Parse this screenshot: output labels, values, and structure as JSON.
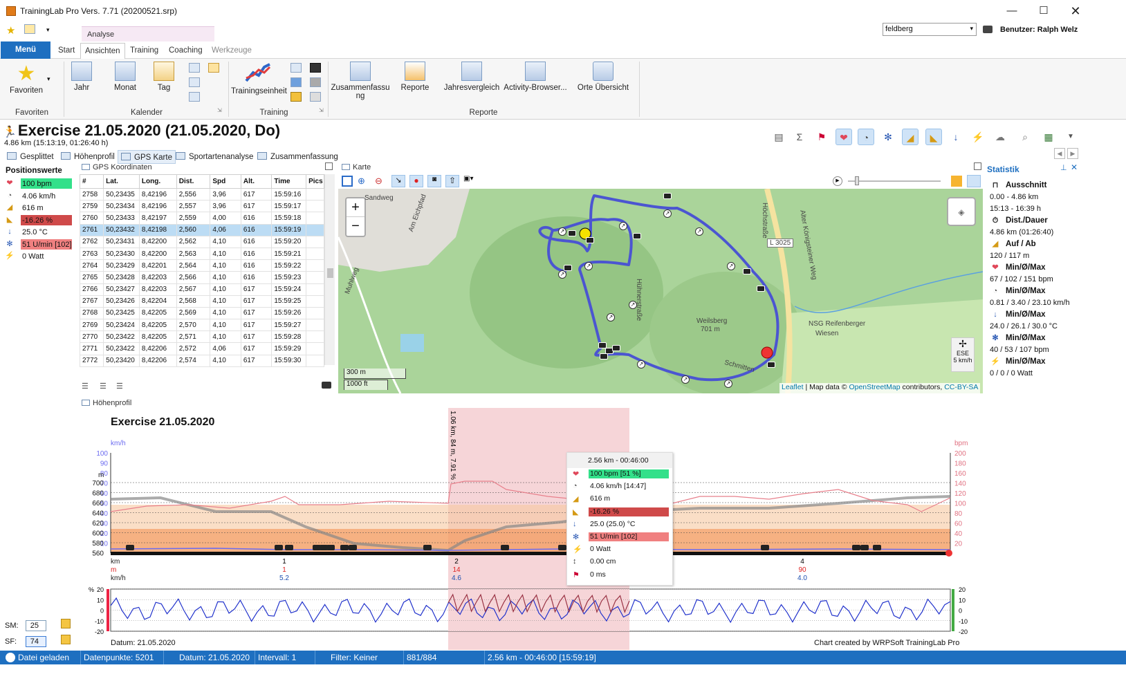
{
  "window": {
    "title": "TrainingLab Pro Vers. 7.71 (20200521.srp)",
    "user_select": "feldberg",
    "user_label": "Benutzer: Ralph Welz"
  },
  "ribbon": {
    "context_tab": "Analyse",
    "tabs": [
      "Menü",
      "Start",
      "Ansichten",
      "Training",
      "Coaching",
      "Werkzeuge"
    ],
    "groups": {
      "favoriten": {
        "label": "Favoriten",
        "buttons": [
          "Favoriten"
        ]
      },
      "kalender": {
        "label": "Kalender",
        "buttons": [
          "Jahr",
          "Monat",
          "Tag"
        ]
      },
      "training": {
        "label": "Training",
        "buttons": [
          "Trainingseinheit"
        ]
      },
      "reporte": {
        "label": "Reporte",
        "buttons": [
          "Zusammenfassu",
          "ng",
          "Reporte",
          "Jahresvergleich",
          "Activity-Browser...",
          "Orte Übersicht"
        ]
      }
    }
  },
  "exercise": {
    "title": "Exercise 21.05.2020 (21.05.2020, Do)",
    "subtitle": "4.86 km (15:13:19, 01:26:40 h)"
  },
  "view_tabs": [
    "Gesplittet",
    "Höhenprofil",
    "GPS Karte",
    "Sportartenanalyse",
    "Zusammenfassung"
  ],
  "position": {
    "header": "Positionswerte",
    "values": [
      {
        "icon": "heart-icon",
        "text": "100 bpm",
        "bg": "#33e08a"
      },
      {
        "icon": "speedometer-icon",
        "text": "4.06 km/h",
        "bg": ""
      },
      {
        "icon": "altitude-icon",
        "text": "616 m",
        "bg": ""
      },
      {
        "icon": "gradient-icon",
        "text": "-16.26 %",
        "bg": "#cf4a4a"
      },
      {
        "icon": "thermometer-icon",
        "text": "25.0 °C",
        "bg": ""
      },
      {
        "icon": "cadence-icon",
        "text": "51 U/min [102]",
        "bg": "#f08080"
      },
      {
        "icon": "power-icon",
        "text": "0 Watt",
        "bg": ""
      }
    ]
  },
  "gps": {
    "panel_title": "GPS Koordinaten",
    "columns": [
      "#",
      "Lat.",
      "Long.",
      "Dist.",
      "Spd",
      "Alt.",
      "Time",
      "Pics"
    ],
    "rows": [
      [
        "2758",
        "50,23435",
        "8,42196",
        "2,556",
        "3,96",
        "617",
        "15:59:16",
        ""
      ],
      [
        "2759",
        "50,23434",
        "8,42196",
        "2,557",
        "3,96",
        "617",
        "15:59:17",
        ""
      ],
      [
        "2760",
        "50,23433",
        "8,42197",
        "2,559",
        "4,00",
        "616",
        "15:59:18",
        ""
      ],
      [
        "2761",
        "50,23432",
        "8,42198",
        "2,560",
        "4,06",
        "616",
        "15:59:19",
        ""
      ],
      [
        "2762",
        "50,23431",
        "8,42200",
        "2,562",
        "4,10",
        "616",
        "15:59:20",
        ""
      ],
      [
        "2763",
        "50,23430",
        "8,42200",
        "2,563",
        "4,10",
        "616",
        "15:59:21",
        ""
      ],
      [
        "2764",
        "50,23429",
        "8,42201",
        "2,564",
        "4,10",
        "616",
        "15:59:22",
        ""
      ],
      [
        "2765",
        "50,23428",
        "8,42203",
        "2,566",
        "4,10",
        "616",
        "15:59:23",
        ""
      ],
      [
        "2766",
        "50,23427",
        "8,42203",
        "2,567",
        "4,10",
        "617",
        "15:59:24",
        ""
      ],
      [
        "2767",
        "50,23426",
        "8,42204",
        "2,568",
        "4,10",
        "617",
        "15:59:25",
        ""
      ],
      [
        "2768",
        "50,23425",
        "8,42205",
        "2,569",
        "4,10",
        "617",
        "15:59:26",
        ""
      ],
      [
        "2769",
        "50,23424",
        "8,42205",
        "2,570",
        "4,10",
        "617",
        "15:59:27",
        ""
      ],
      [
        "2770",
        "50,23422",
        "8,42205",
        "2,571",
        "4,10",
        "617",
        "15:59:28",
        ""
      ],
      [
        "2771",
        "50,23422",
        "8,42206",
        "2,572",
        "4,06",
        "617",
        "15:59:29",
        ""
      ],
      [
        "2772",
        "50,23420",
        "8,42206",
        "2,574",
        "4,10",
        "617",
        "15:59:30",
        ""
      ]
    ],
    "selected_row": 3
  },
  "map": {
    "panel_title": "Karte",
    "labels": [
      "Sandweg",
      "Am Eichpfad",
      "Höchstraße",
      "L 3025",
      "Weilsberg",
      "701 m",
      "NSG Reifenberger",
      "Wiesen",
      "Hühnerstraße",
      "Alter Königsteiner Weg",
      "Muhlweg",
      "Schmitten"
    ],
    "scale": [
      "300 m",
      "1000 ft"
    ],
    "attribution_leaflet": "Leaflet",
    "attribution_text": "| Map data ©",
    "attribution_osm": "OpenStreetMap",
    "attribution_rest": "contributors,",
    "attribution_license": "CC-BY-SA",
    "wind": {
      "dir": "ESE",
      "speed": "5 km/h"
    },
    "zoom_in": "+",
    "zoom_out": "−"
  },
  "statistik": {
    "panel_title": "Statistik",
    "items": [
      {
        "icon": "section-icon",
        "label": "Ausschnitt",
        "lines": [
          "0.00 - 4.86 km",
          "15:13 - 16:39 h"
        ]
      },
      {
        "icon": "duration-icon",
        "label": "Dist./Dauer",
        "lines": [
          "4.86 km (01:26:40)"
        ]
      },
      {
        "icon": "altitude-icon",
        "label": "Auf / Ab",
        "lines": [
          "120 / 117 m"
        ]
      },
      {
        "icon": "heart-icon",
        "label": "Min/Ø/Max",
        "lines": [
          "67 / 102 / 151 bpm"
        ]
      },
      {
        "icon": "speedometer-icon",
        "label": "Min/Ø/Max",
        "lines": [
          "0.81 / 3.40 / 23.10 km/h"
        ]
      },
      {
        "icon": "thermometer-icon",
        "label": "Min/Ø/Max",
        "lines": [
          "24.0 / 26.1 / 30.0 °C"
        ]
      },
      {
        "icon": "cadence-icon",
        "label": "Min/Ø/Max",
        "lines": [
          "40 / 53 / 107 bpm"
        ]
      },
      {
        "icon": "power-icon",
        "label": "Min/Ø/Max",
        "lines": [
          "0 / 0 / 0 Watt"
        ]
      }
    ]
  },
  "profile": {
    "panel_title": "Höhenprofil",
    "title": "Exercise 21.05.2020",
    "left_unit_speed": "km/h",
    "left_unit_alt": "m",
    "right_unit": "bpm",
    "speed_ticks": [
      "100",
      "90",
      "80",
      "70",
      "60",
      "50",
      "40",
      "30",
      "20",
      "10"
    ],
    "alt_ticks": [
      "700",
      "680",
      "660",
      "640",
      "620",
      "600",
      "580",
      "560"
    ],
    "bpm_ticks": [
      "200",
      "180",
      "160",
      "140",
      "120",
      "100",
      "80",
      "60",
      "40",
      "20"
    ],
    "row_labels": [
      "km",
      "m",
      "km/h"
    ],
    "km_marks": [
      {
        "km": "1",
        "m": "1",
        "spd": "5.2"
      },
      {
        "km": "2",
        "m": "14",
        "spd": "4.6"
      },
      {
        "km": "4",
        "m": "90",
        "spd": "4.0"
      }
    ],
    "vertical_note": "1.06 km, 84 m, 7.91 %",
    "grad_unit": "%",
    "grad_ticks": [
      "20",
      "10",
      "0",
      "-10",
      "-20"
    ],
    "date": "Datum: 21.05.2020",
    "credit": "Chart created by WRPSoft TrainingLab Pro",
    "tooltip": {
      "header": "2.56 km - 00:46:00",
      "rows": [
        {
          "icon": "heart-icon",
          "text": "100 bpm [51 %]",
          "bg": "#33e08a"
        },
        {
          "icon": "speedometer-icon",
          "text": "4.06 km/h [14:47]",
          "bg": ""
        },
        {
          "icon": "altitude-icon",
          "text": "616 m",
          "bg": ""
        },
        {
          "icon": "gradient-icon",
          "text": "-16.26 %",
          "bg": "#cf4a4a"
        },
        {
          "icon": "thermometer-icon",
          "text": "25.0 (25.0) °C",
          "bg": ""
        },
        {
          "icon": "cadence-icon",
          "text": "51 U/min [102]",
          "bg": "#f08080"
        },
        {
          "icon": "power-icon",
          "text": "0 Watt",
          "bg": ""
        },
        {
          "icon": "vertical-speed-icon",
          "text": "0.00 cm",
          "bg": ""
        },
        {
          "icon": "runner-icon",
          "text": "0 ms",
          "bg": ""
        }
      ]
    }
  },
  "side_controls": {
    "sm_label": "SM:",
    "sm_value": "25",
    "sf_label": "SF:",
    "sf_value": "74"
  },
  "status": {
    "loaded": "Datei geladen",
    "points": "Datenpunkte: 5201",
    "date": "Datum: 21.05.2020",
    "interval": "Intervall: 1",
    "filter": "Filter: Keiner",
    "count": "881/884",
    "position": "2.56 km - 00:46:00 [15:59:19]"
  }
}
